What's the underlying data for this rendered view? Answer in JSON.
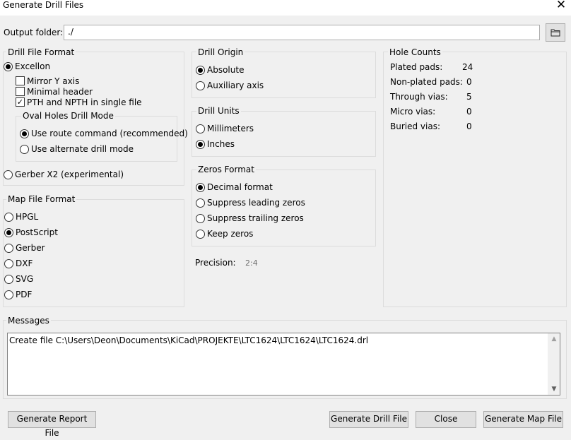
{
  "window": {
    "title": "Generate Drill Files"
  },
  "output": {
    "label": "Output folder:",
    "value": "./"
  },
  "drill_file_format": {
    "title": "Drill File Format",
    "excellon_label": "Excellon",
    "mirror_y_label": "Mirror Y axis",
    "mirror_y_checked": false,
    "minimal_header_label": "Minimal header",
    "minimal_header_checked": false,
    "pth_npth_label": "PTH and NPTH in single file",
    "pth_npth_checked": true,
    "oval_title": "Oval Holes Drill Mode",
    "route_label": "Use route command (recommended)",
    "alternate_label": "Use alternate drill mode",
    "gerber_x2_label": "Gerber X2 (experimental)",
    "selected": "Excellon",
    "oval_selected": "route"
  },
  "map_file_format": {
    "title": "Map File Format",
    "options": [
      "HPGL",
      "PostScript",
      "Gerber",
      "DXF",
      "SVG",
      "PDF"
    ],
    "selected": "PostScript"
  },
  "drill_origin": {
    "title": "Drill Origin",
    "options": [
      "Absolute",
      "Auxiliary axis"
    ],
    "selected": "Absolute"
  },
  "drill_units": {
    "title": "Drill Units",
    "options": [
      "Millimeters",
      "Inches"
    ],
    "selected": "Inches"
  },
  "zeros_format": {
    "title": "Zeros Format",
    "options": [
      "Decimal format",
      "Suppress leading zeros",
      "Suppress trailing zeros",
      "Keep zeros"
    ],
    "selected": "Decimal format"
  },
  "precision": {
    "label": "Precision:",
    "value": "2:4"
  },
  "hole_counts": {
    "title": "Hole Counts",
    "rows": [
      {
        "label": "Plated pads:",
        "value": "24"
      },
      {
        "label": "Non-plated pads:",
        "value": "0"
      },
      {
        "label": "Through vias:",
        "value": "5"
      },
      {
        "label": "Micro vias:",
        "value": "0"
      },
      {
        "label": "Buried vias:",
        "value": "0"
      }
    ]
  },
  "messages": {
    "title": "Messages",
    "text": "Create file C:\\Users\\Deon\\Documents\\KiCad\\PROJEKTE\\LTC1624\\LTC1624\\LTC1624.drl"
  },
  "buttons": {
    "report": "Generate Report File",
    "drill": "Generate Drill File",
    "close": "Close",
    "map": "Generate Map File"
  },
  "icons": {
    "close": "close-icon",
    "folder": "folder-icon",
    "scroll_up": "chevron-up-icon",
    "scroll_down": "chevron-down-icon"
  }
}
